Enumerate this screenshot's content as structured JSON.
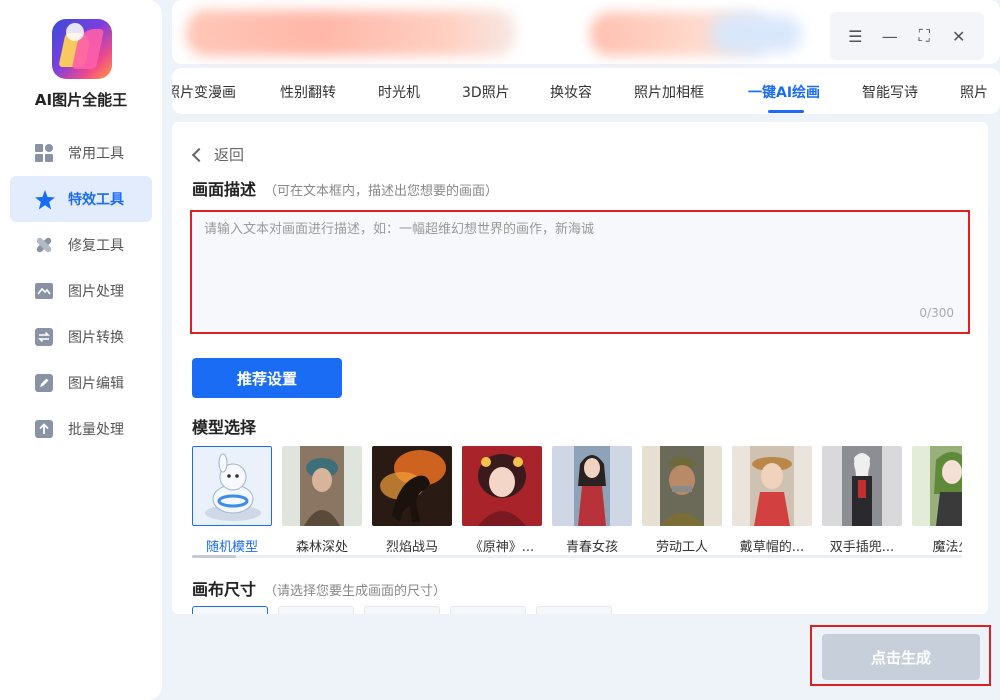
{
  "app": {
    "title": "AI图片全能王"
  },
  "sidebar": {
    "items": [
      {
        "label": "常用工具",
        "icon": "grid-icon"
      },
      {
        "label": "特效工具",
        "icon": "star-icon",
        "active": true
      },
      {
        "label": "修复工具",
        "icon": "bandage-icon"
      },
      {
        "label": "图片处理",
        "icon": "image-icon"
      },
      {
        "label": "图片转换",
        "icon": "convert-icon"
      },
      {
        "label": "图片编辑",
        "icon": "edit-icon"
      },
      {
        "label": "批量处理",
        "icon": "upload-icon"
      }
    ]
  },
  "window_controls": {
    "menu": "☰",
    "minimize": "—",
    "maximize": "⛶",
    "close": "✕"
  },
  "tabs": [
    {
      "label": "照片变漫画"
    },
    {
      "label": "性别翻转"
    },
    {
      "label": "时光机"
    },
    {
      "label": "3D照片"
    },
    {
      "label": "换妆容"
    },
    {
      "label": "照片加相框"
    },
    {
      "label": "一键AI绘画",
      "active": true
    },
    {
      "label": "智能写诗"
    },
    {
      "label": "照片"
    }
  ],
  "main": {
    "back_label": "返回",
    "description": {
      "title": "画面描述",
      "hint": "（可在文本框内，描述出您想要的画面）",
      "placeholder": "请输入文本对画面进行描述，如：一幅超维幻想世界的画作，新海诚",
      "value": "",
      "counter": "0/300"
    },
    "recommend_button": "推荐设置",
    "model_section": {
      "title": "模型选择",
      "models": [
        {
          "name": "随机模型",
          "selected": true
        },
        {
          "name": "森林深处"
        },
        {
          "name": "烈焰战马"
        },
        {
          "name": "《原神》..."
        },
        {
          "name": "青春女孩"
        },
        {
          "name": "劳动工人"
        },
        {
          "name": "戴草帽的..."
        },
        {
          "name": "双手插兜..."
        },
        {
          "name": "魔法少"
        }
      ]
    },
    "canvas_section": {
      "title": "画布尺寸",
      "hint": "（请选择您要生成画面的尺寸）"
    }
  },
  "generate_button": "点击生成",
  "colors": {
    "accent": "#1a6cf5",
    "highlight_outline": "#e02020",
    "disabled_button": "#c7cfda"
  }
}
